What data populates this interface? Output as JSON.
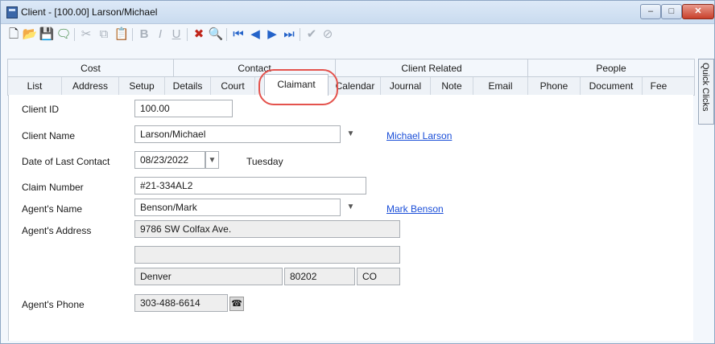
{
  "window": {
    "title": "Client - [100.00] Larson/Michael",
    "minimize_symbol": "–",
    "maximize_symbol": "□",
    "close_symbol": "✕"
  },
  "toolbar": {
    "icons": [
      "new-document-icon",
      "open-folder-icon",
      "save-icon",
      "comment-icon",
      "cut-icon",
      "copy-icon",
      "paste-icon",
      "bold-icon",
      "italic-icon",
      "underline-icon",
      "delete-icon",
      "search-icon",
      "first-record-icon",
      "previous-record-icon",
      "next-record-icon",
      "last-record-icon",
      "check-icon",
      "cancel-icon"
    ],
    "disabled": [
      "cut-icon",
      "copy-icon",
      "paste-icon",
      "bold-icon",
      "italic-icon",
      "underline-icon",
      "check-icon",
      "cancel-icon"
    ]
  },
  "tab_groups": [
    {
      "label": "Cost"
    },
    {
      "label": "Contact"
    },
    {
      "label": "Client Related"
    },
    {
      "label": "People"
    }
  ],
  "tabs": [
    {
      "label": "List"
    },
    {
      "label": "Address"
    },
    {
      "label": "Setup"
    },
    {
      "label": "Details"
    },
    {
      "label": "Court"
    },
    {
      "label": "Claimant"
    },
    {
      "label": "Calendar"
    },
    {
      "label": "Journal"
    },
    {
      "label": "Note"
    },
    {
      "label": "Email"
    },
    {
      "label": "Phone"
    },
    {
      "label": "Document"
    },
    {
      "label": "Fee"
    }
  ],
  "active_tab": "Claimant",
  "quick_clicks": "Quick Clicks",
  "form": {
    "client_id_label": "Client ID",
    "client_id": "100.00",
    "client_name_label": "Client Name",
    "client_name": "Larson/Michael",
    "client_link": "Michael Larson",
    "last_contact_label": "Date of Last Contact",
    "last_contact_date": "08/23/2022",
    "last_contact_day": "Tuesday",
    "claim_number_label": "Claim Number",
    "claim_number": "#21-334AL2",
    "agent_name_label": "Agent's Name",
    "agent_name": "Benson/Mark",
    "agent_link": "Mark Benson",
    "agent_address_label": "Agent's Address",
    "agent_address_line1": "9786 SW Colfax Ave.",
    "agent_address_line2": "",
    "agent_city": "Denver",
    "agent_zip": "80202",
    "agent_state": "CO",
    "agent_phone_label": "Agent's Phone",
    "agent_phone": "303-488-6614"
  },
  "colors": {
    "highlight": "#e4534d",
    "link": "#1a4ed8"
  }
}
